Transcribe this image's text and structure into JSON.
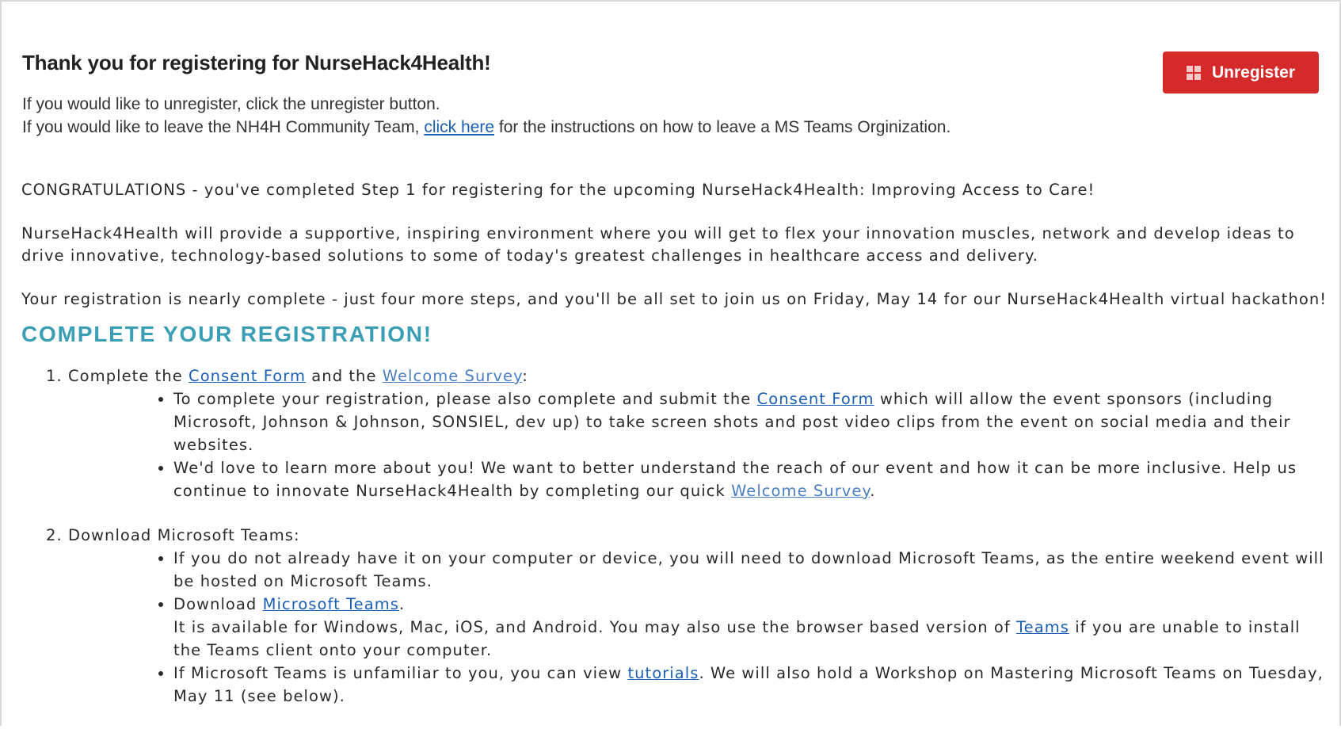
{
  "header": {
    "title": "Thank you for registering for NurseHack4Health!",
    "line1": "If you would like to unregister, click the unregister button.",
    "line2_before": "If you would like to leave the NH4H Community Team, ",
    "line2_link": "click here",
    "line2_after": " for the instructions on how to leave a MS Teams Orginization."
  },
  "unregister_button": {
    "label": "Unregister",
    "icon": "windows-icon",
    "color": "#d62a2a"
  },
  "body": {
    "congrats": "CONGRATULATIONS - you've completed Step 1 for registering for the upcoming NurseHack4Health: Improving Access to Care!",
    "para2": "NurseHack4Health will provide a supportive, inspiring environment where you will get to flex your innovation muscles, network and develop ideas to drive innovative, technology-based solutions to some of today's greatest challenges in healthcare access and delivery.",
    "para3": "Your registration is nearly complete - just four more steps, and you'll be all set to join us on Friday, May 14 for our NurseHack4Health virtual hackathon!",
    "section_heading": "COMPLETE YOUR REGISTRATION!",
    "heading_color": "#3a9fb5"
  },
  "steps": {
    "step1": {
      "before": "Complete the ",
      "link1": "Consent Form",
      "mid": " and the ",
      "link2": "Welcome Survey",
      "after": ":",
      "bullet1_before": "To complete your registration, please also complete and submit the ",
      "bullet1_link": "Consent Form",
      "bullet1_after": " which will allow the event sponsors (including Microsoft, Johnson & Johnson, SONSIEL, dev up) to take screen shots and post video clips from the event on social media and their websites.",
      "bullet2_before": "We'd love to learn more about you! We want to better understand the reach of our event and how it can be more inclusive. Help us continue to innovate NurseHack4Health by completing our quick ",
      "bullet2_link": "Welcome Survey",
      "bullet2_after": "."
    },
    "step2": {
      "label": "Download Microsoft Teams:",
      "bullet1": "If you do not already have it on your computer or device, you will need to download Microsoft Teams, as the entire weekend event will be hosted on Microsoft Teams.",
      "bullet2_before": "Download ",
      "bullet2_link": "Microsoft Teams",
      "bullet2_after": ".",
      "bullet2_line2_before": "It is available for Windows, Mac, iOS, and Android. You may also use the browser based version of ",
      "bullet2_line2_link": "Teams",
      "bullet2_line2_after": " if you are unable to install the Teams client onto your computer.",
      "bullet3_before": "If Microsoft Teams is unfamiliar to you, you can view ",
      "bullet3_link": "tutorials",
      "bullet3_after": ". We will also hold a Workshop on Mastering Microsoft Teams on Tuesday, May 11 (see below)."
    }
  }
}
